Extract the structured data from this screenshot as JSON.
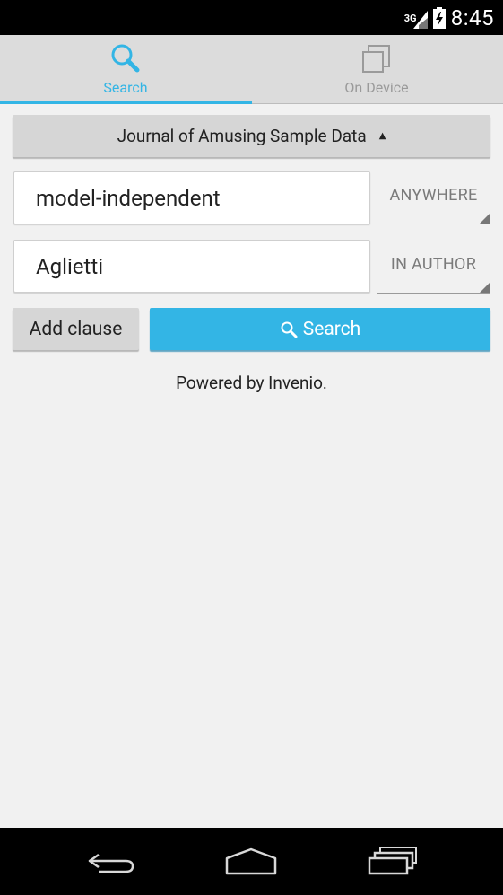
{
  "status_bar": {
    "network": "3G",
    "time": "8:45"
  },
  "tabs": [
    {
      "label": "Search",
      "icon": "search-icon",
      "selected": true
    },
    {
      "label": "On Device",
      "icon": "copy-icon",
      "selected": false
    }
  ],
  "collection": {
    "selected": "Journal of Amusing Sample Data"
  },
  "clauses": [
    {
      "value": "model-independent",
      "field": "ANYWHERE"
    },
    {
      "value": "Aglietti",
      "field": "IN AUTHOR"
    }
  ],
  "buttons": {
    "add_clause": "Add clause",
    "search": "Search"
  },
  "footer": {
    "powered_by": "Powered by Invenio."
  },
  "colors": {
    "accent": "#33b5e5",
    "background": "#f1f1f1"
  }
}
